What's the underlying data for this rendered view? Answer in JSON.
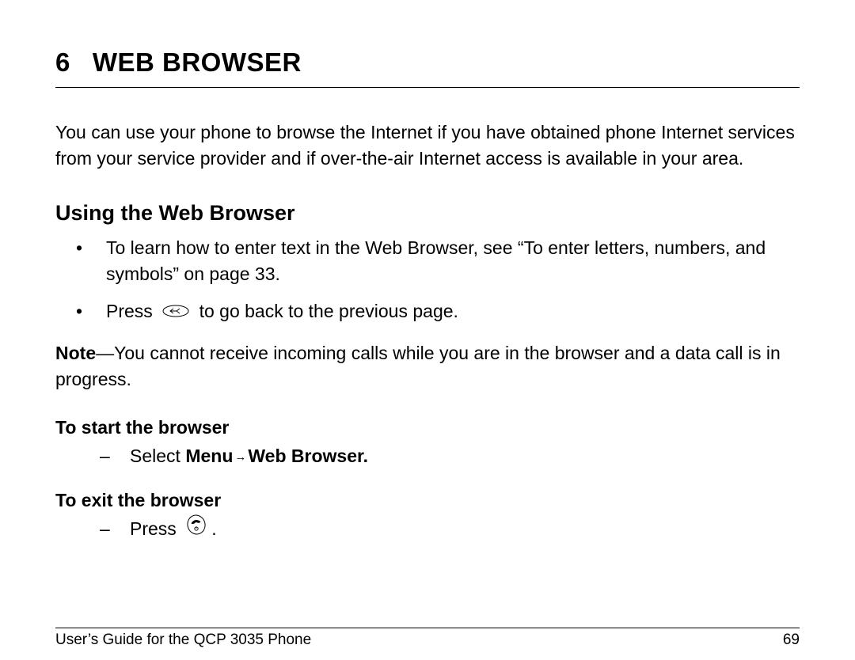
{
  "chapter": {
    "number": "6",
    "title": "WEB BROWSER"
  },
  "intro": "You can use your phone to browse the Internet if you have obtained phone Internet services from your service provider and if over-the-air Internet access is available in your area.",
  "section": {
    "heading": "Using the Web Browser",
    "bullets": [
      "To learn how to enter text in the Web Browser, see “To enter letters, numbers, and symbols” on page 33.",
      {
        "pre": "Press ",
        "icon": "back-button-icon",
        "post": " to go back to the previous page."
      }
    ],
    "note_label": "Note",
    "note_body": "—You cannot receive incoming calls while you are in the browser and a data call is in progress.",
    "sub1": {
      "heading": "To start the browser",
      "item_prefix": "Select ",
      "menu_label": "Menu",
      "arrow_glyph": "→",
      "target_label": "Web Browser."
    },
    "sub2": {
      "heading": "To exit the browser",
      "item_prefix": "Press ",
      "period": "."
    }
  },
  "footer": {
    "left": "User’s Guide for the QCP 3035 Phone",
    "right": "69"
  }
}
